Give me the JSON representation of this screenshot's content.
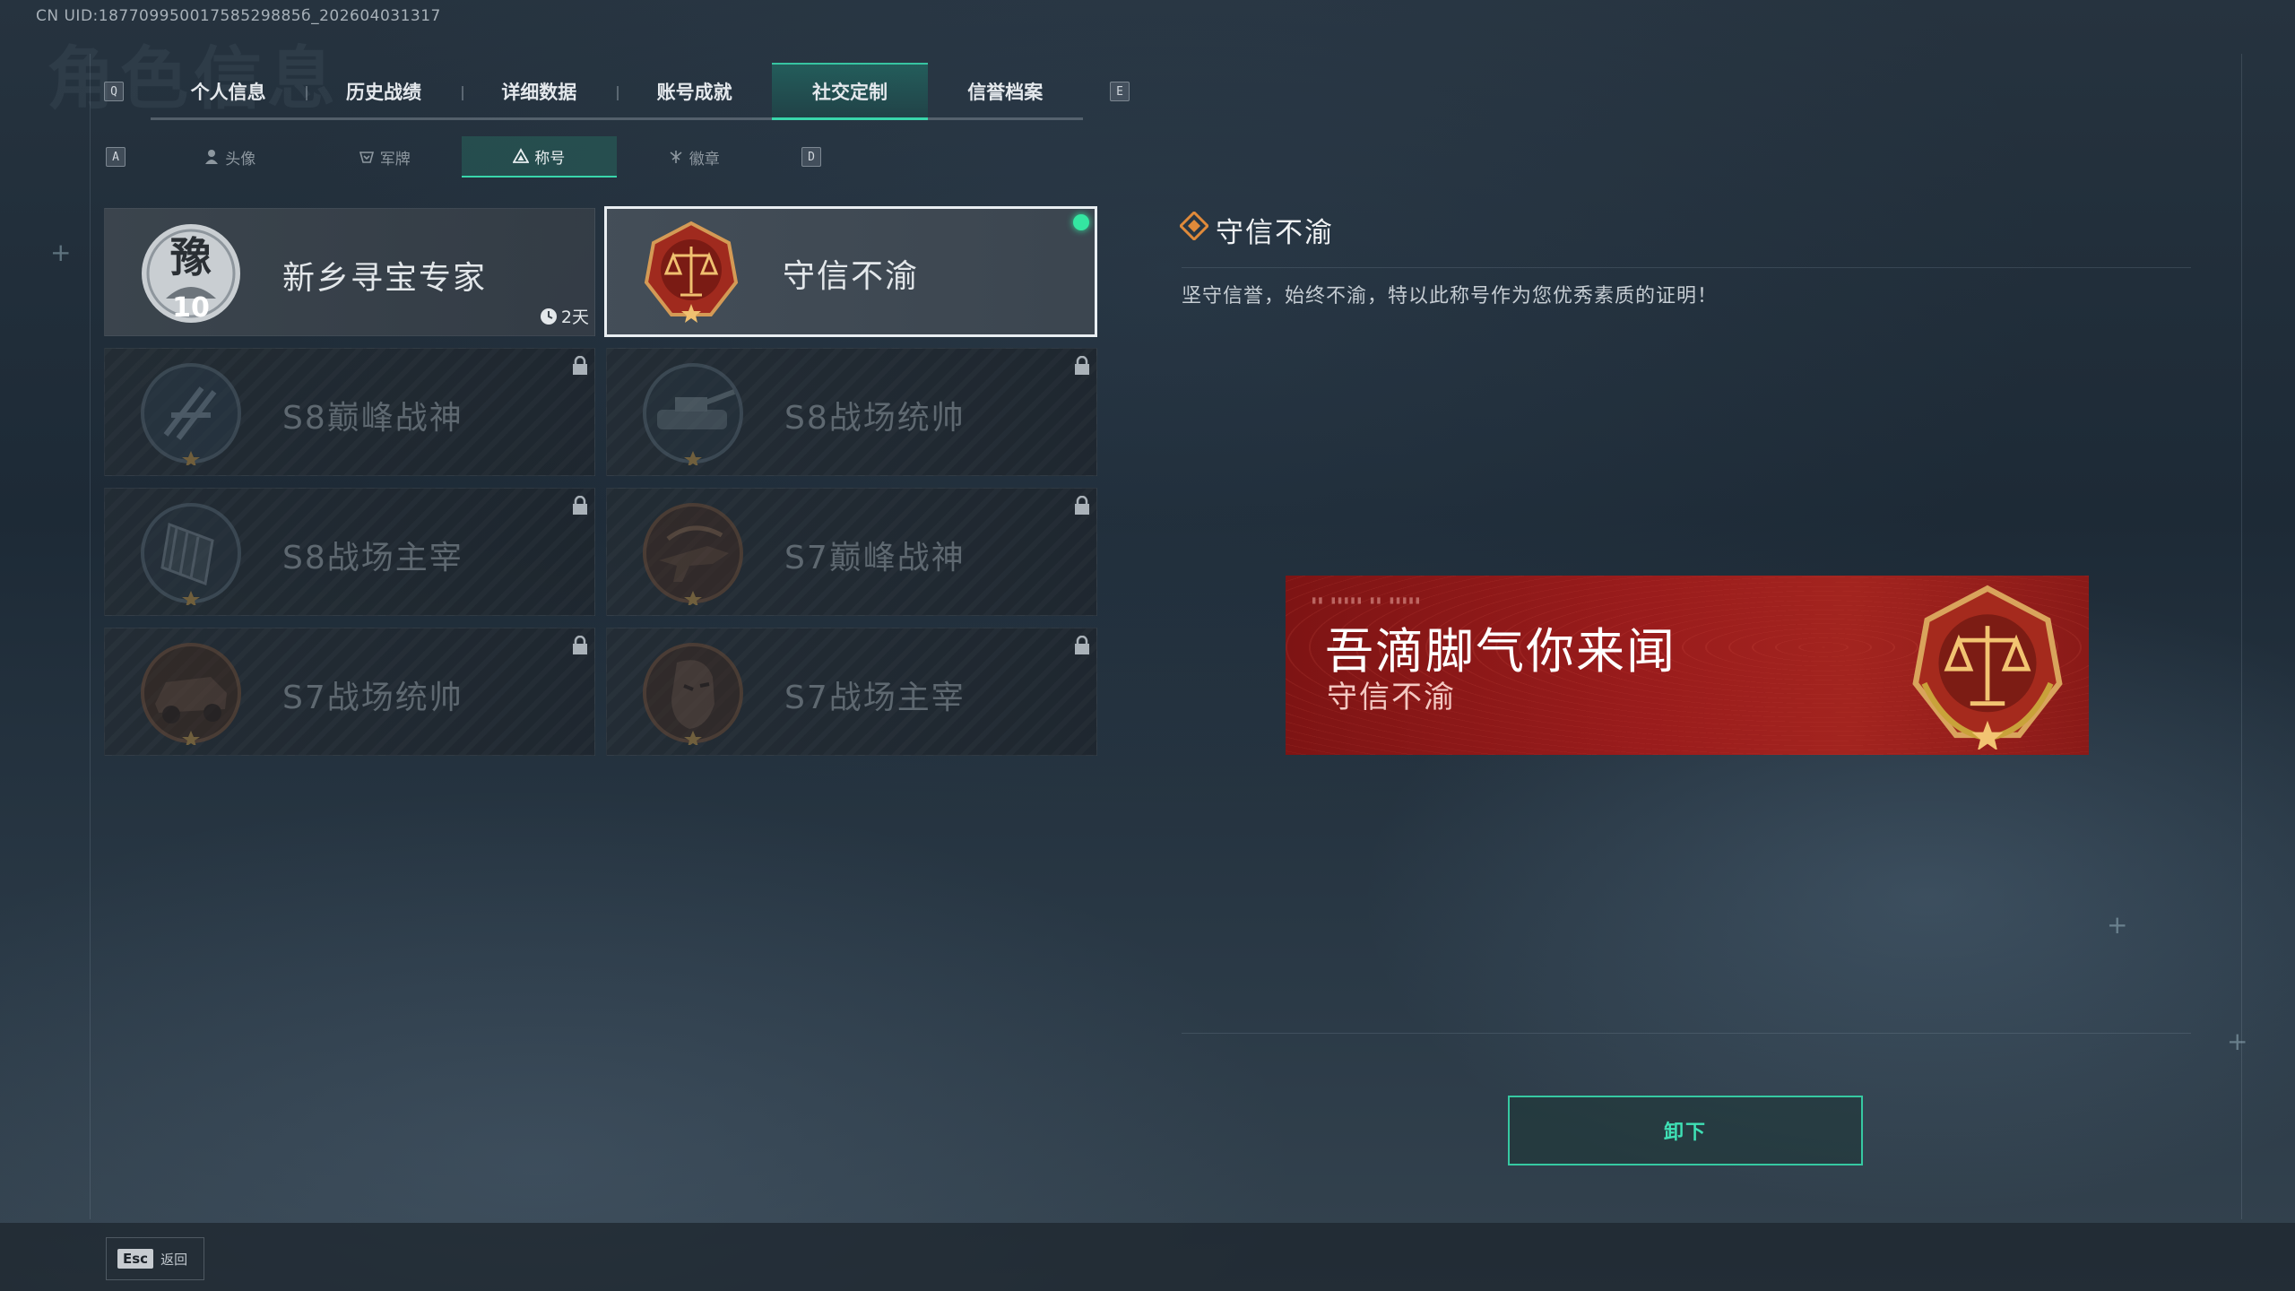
{
  "meta": {
    "uid": "CN UID:18770995001758529885б_202604031317"
  },
  "header": {
    "ghost_title": "角色信息"
  },
  "tabs": {
    "prev_key": "Q",
    "next_key": "E",
    "items": [
      {
        "label": "个人信息"
      },
      {
        "label": "历史战绩"
      },
      {
        "label": "详细数据"
      },
      {
        "label": "账号成就"
      },
      {
        "label": "社交定制",
        "active": true
      },
      {
        "label": "信誉档案"
      }
    ]
  },
  "subtabs": {
    "prev_key": "A",
    "next_key": "D",
    "items": [
      {
        "label": "头像",
        "icon": "person-icon"
      },
      {
        "label": "军牌",
        "icon": "dogtag-icon"
      },
      {
        "label": "称号",
        "icon": "title-icon",
        "active": true
      },
      {
        "label": "徽章",
        "icon": "badge-icon"
      }
    ]
  },
  "titles": [
    {
      "name": "新乡寻宝专家",
      "emblem": "豫",
      "emblem_number": "10",
      "timer": "2天",
      "state": "unlocked"
    },
    {
      "name": "守信不渝",
      "state": "selected",
      "equipped": true
    },
    {
      "name": "S8巅峰战神",
      "state": "locked"
    },
    {
      "name": "S8战场统帅",
      "state": "locked"
    },
    {
      "name": "S8战场主宰",
      "state": "locked"
    },
    {
      "name": "S7巅峰战神",
      "state": "locked"
    },
    {
      "name": "S7战场统帅",
      "state": "locked"
    },
    {
      "name": "S7战场主宰",
      "state": "locked"
    }
  ],
  "detail": {
    "title": "守信不渝",
    "description": "坚守信誉，始终不渝，特以此称号作为您优秀素质的证明！"
  },
  "banner": {
    "player_name": "吾滴脚气你来闻",
    "title": "守信不渝",
    "color": "#9a1c1c"
  },
  "actions": {
    "unequip_label": "卸下"
  },
  "footer": {
    "esc_key": "Esc",
    "esc_label": "返回"
  },
  "colors": {
    "accent": "#39d6ab",
    "equipped_dot": "#34e6a1"
  }
}
